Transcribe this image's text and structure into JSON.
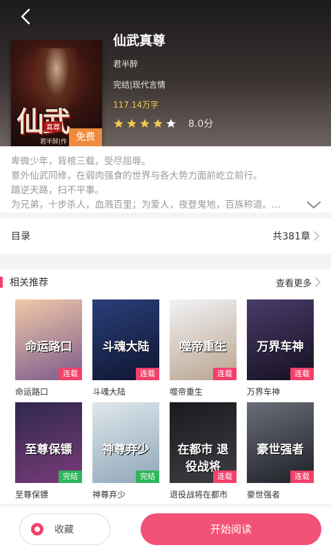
{
  "book": {
    "title": "仙武真尊",
    "author": "君半醉",
    "status": "完结|现代言情",
    "words": "117.14万字",
    "stars": 4.5,
    "score": "8.0分",
    "free_label": "免费",
    "cover_title": "仙武",
    "cover_stamp": "真尊",
    "cover_author": "君半醉|作"
  },
  "synopsis": [
    "卑微少年，背棺三载，受尽屈辱。",
    "意外仙武同修，在弱肉强食的世界与各大势力面前屹立前行。",
    "踏逆天路，扫不平事。",
    "为兄弟，十步杀人，血溅百里；为爱人，夜登鬼地，百族称道。..."
  ],
  "toc": {
    "label": "目录",
    "count": "共381章"
  },
  "recommend": {
    "title": "相关推荐",
    "more": "查看更多",
    "books": [
      {
        "name": "命运路口",
        "tag": "连载",
        "art": "命运路口",
        "colors": [
          "#f1c9a8",
          "#7b5a8c"
        ],
        "tag_color": "#f2406a"
      },
      {
        "name": "斗魂大陆",
        "tag": "连载",
        "art": "斗魂大陆",
        "colors": [
          "#2a3f7a",
          "#0e1530"
        ],
        "tag_color": "#f2406a"
      },
      {
        "name": "噬帝重生",
        "tag": "连载",
        "art": "噬帝重生",
        "colors": [
          "#f2f2f6",
          "#b9a48e"
        ],
        "tag_color": "#f2406a"
      },
      {
        "name": "万界车神",
        "tag": "连载",
        "art": "万界车神",
        "colors": [
          "#4a3b6b",
          "#15101f"
        ],
        "tag_color": "#f2406a"
      },
      {
        "name": "至尊保镖",
        "tag": "完结",
        "art": "至尊保镖",
        "colors": [
          "#2f2850",
          "#7a3b78"
        ],
        "tag_color": "#2fb65a"
      },
      {
        "name": "神尊弃少",
        "tag": "完结",
        "art": "神尊弃少",
        "colors": [
          "#dfe7ec",
          "#8fa7b8"
        ],
        "tag_color": "#2fb65a"
      },
      {
        "name": "退役战将在都市",
        "tag": "连载",
        "art": "在都市 退役战将",
        "colors": [
          "#1a1a1e",
          "#3d3d44"
        ],
        "tag_color": "#f2406a"
      },
      {
        "name": "豪世强者",
        "tag": "连载",
        "art": "豪世强者",
        "colors": [
          "#6a6e78",
          "#1e2026"
        ],
        "tag_color": "#f2406a"
      }
    ]
  },
  "actions": {
    "favorite": "收藏",
    "start_reading": "开始阅读"
  },
  "colors": {
    "accent": "#f25276",
    "star": "#f2c94c"
  }
}
